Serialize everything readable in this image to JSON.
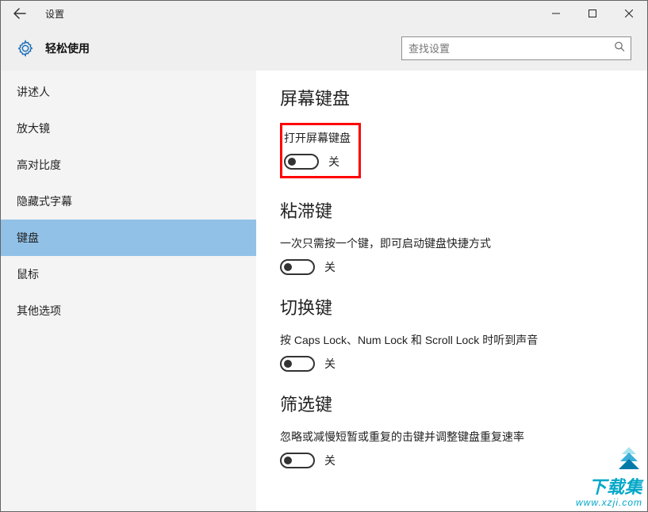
{
  "window": {
    "title": "设置"
  },
  "header": {
    "subtitle": "轻松使用",
    "search_placeholder": "查找设置"
  },
  "sidebar": {
    "items": [
      {
        "label": "讲述人"
      },
      {
        "label": "放大镜"
      },
      {
        "label": "高对比度"
      },
      {
        "label": "隐藏式字幕"
      },
      {
        "label": "键盘"
      },
      {
        "label": "鼠标"
      },
      {
        "label": "其他选项"
      }
    ],
    "selected_index": 4
  },
  "content": {
    "sections": [
      {
        "title": "屏幕键盘",
        "desc": "打开屏幕键盘",
        "toggle_label": "关",
        "highlighted": true
      },
      {
        "title": "粘滞键",
        "desc": "一次只需按一个键，即可启动键盘快捷方式",
        "toggle_label": "关"
      },
      {
        "title": "切换键",
        "desc": "按 Caps Lock、Num Lock 和 Scroll Lock 时听到声音",
        "toggle_label": "关"
      },
      {
        "title": "筛选键",
        "desc": "忽略或减慢短暂或重复的击键并调整键盘重复速率",
        "toggle_label": "关"
      }
    ]
  },
  "watermark": {
    "brand": "下载集",
    "url": "www.xzji.com"
  }
}
